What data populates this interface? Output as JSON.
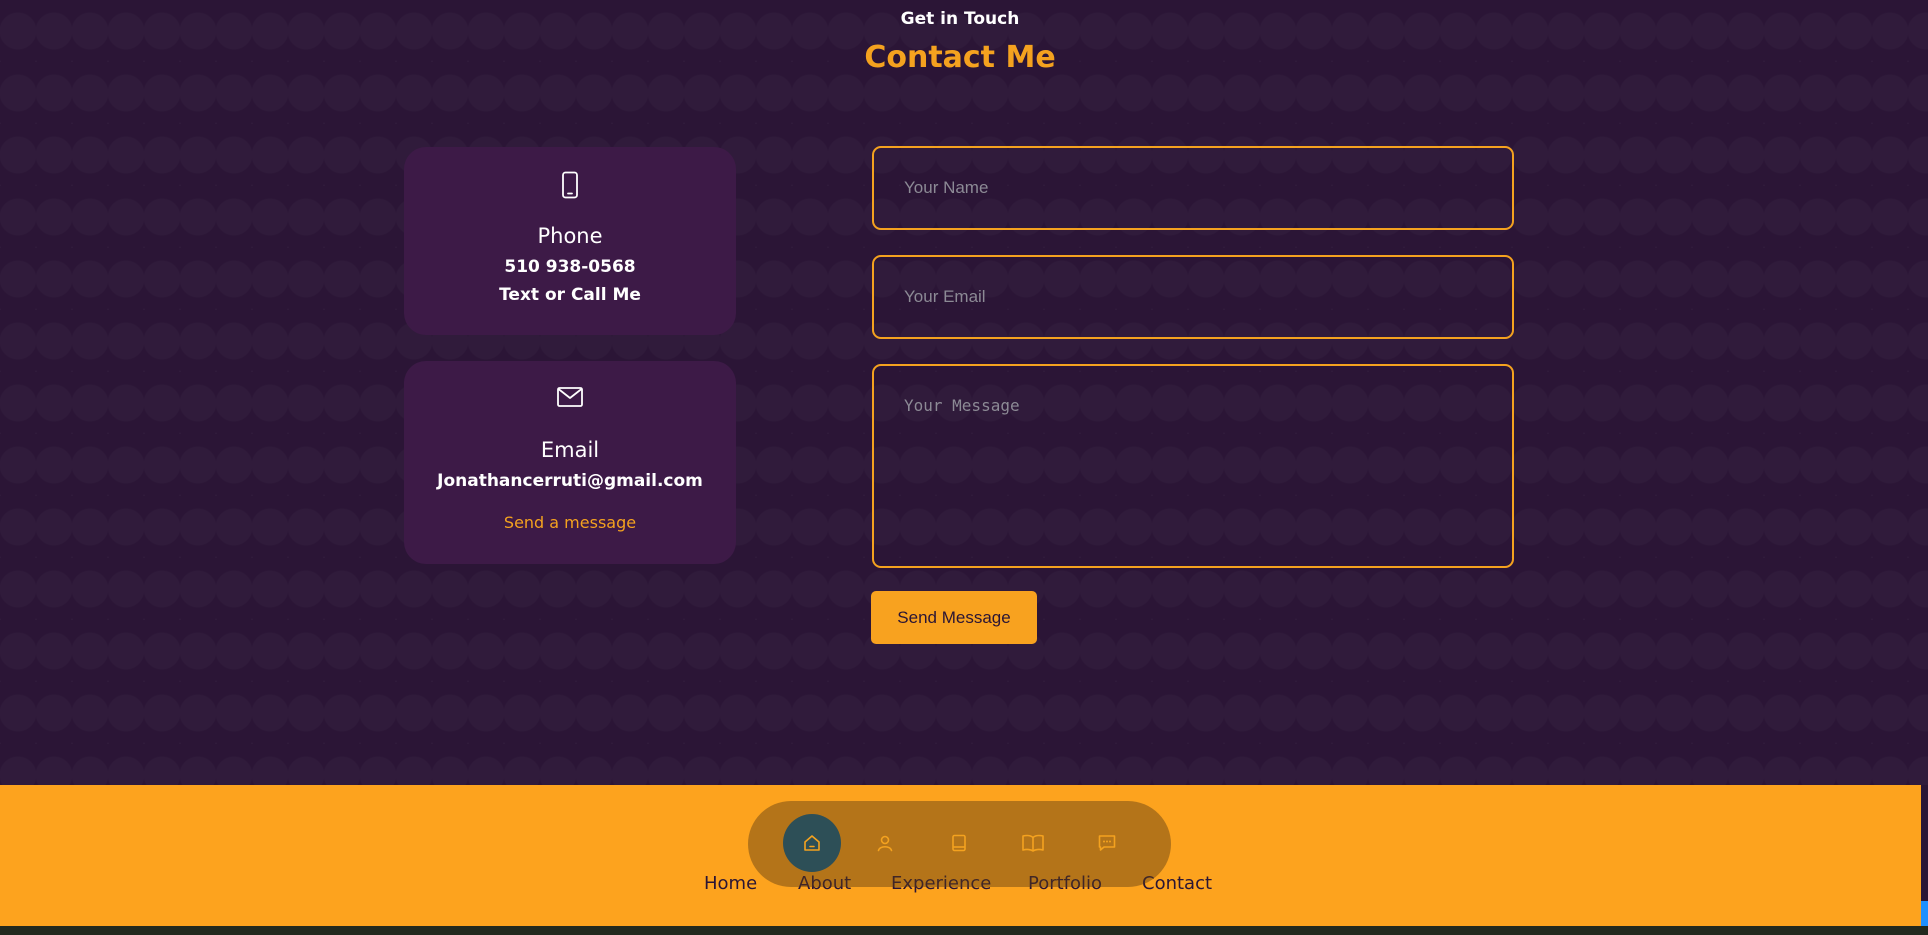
{
  "header": {
    "subtitle": "Get in Touch",
    "title": "Contact Me"
  },
  "cards": {
    "phone": {
      "icon": "phone-icon",
      "title": "Phone",
      "value": "510 938-0568",
      "note": "Text or Call Me"
    },
    "email": {
      "icon": "mail-icon",
      "title": "Email",
      "value": "Jonathancerruti@gmail.com",
      "link": "Send a message"
    }
  },
  "form": {
    "name_placeholder": "Your Name",
    "email_placeholder": "Your Email",
    "message_placeholder": "Your Message",
    "submit_label": "Send Message"
  },
  "footer": {
    "nav_icons": [
      "home-icon",
      "user-icon",
      "book-icon",
      "open-book-icon",
      "message-icon"
    ],
    "links": [
      "Home",
      "About",
      "Experience",
      "Portfolio",
      "Contact"
    ]
  },
  "colors": {
    "background": "#2b1536",
    "card": "#3d1a47",
    "accent": "#f4a21f",
    "footer": "#fda31e",
    "active_nav": "#2d4f57"
  }
}
